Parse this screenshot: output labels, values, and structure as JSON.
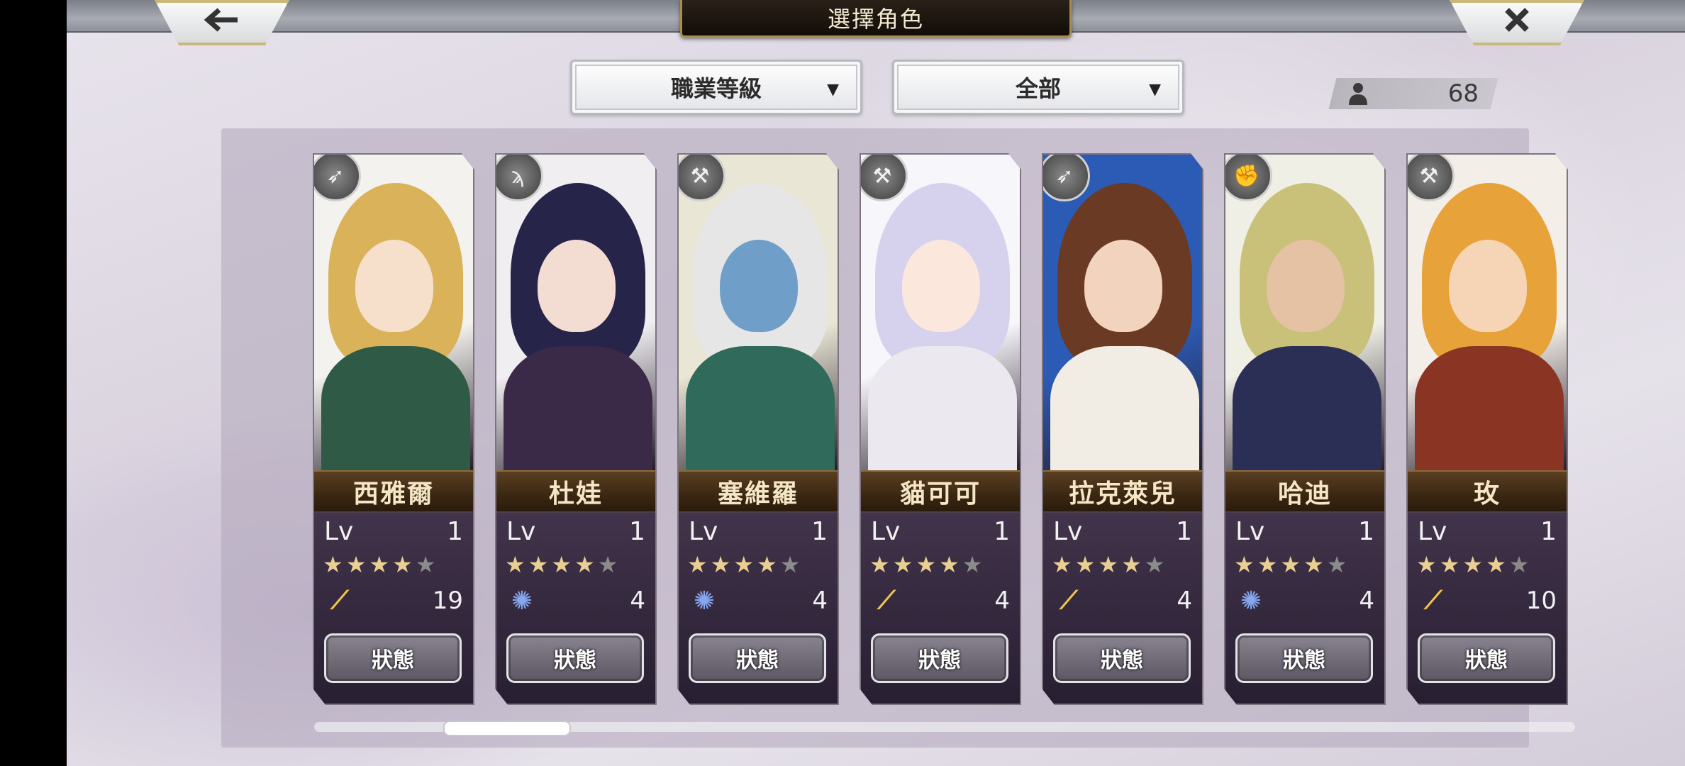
{
  "header": {
    "title": "選擇角色",
    "back_icon": "back-arrow-icon",
    "close_icon": "close-icon"
  },
  "filters": {
    "sort_label": "職業等級",
    "filter_label": "全部"
  },
  "character_count": "68",
  "status_label": "狀態",
  "lv_label": "Lv",
  "colors": {
    "star_on": "#e9cf92",
    "star_off": "#8b8b8b",
    "wing": "#f2c64c",
    "swirl": "#86a6f0"
  },
  "characters": [
    {
      "name": "西雅爾",
      "level": "1",
      "stars": 4,
      "skill_icon": "wing",
      "skill_value": "19",
      "job_icon": "crossbow-icon"
    },
    {
      "name": "杜娃",
      "level": "1",
      "stars": 4,
      "skill_icon": "swirl",
      "skill_value": "4",
      "job_icon": "staff-icon"
    },
    {
      "name": "塞維羅",
      "level": "1",
      "stars": 4,
      "skill_icon": "swirl",
      "skill_value": "4",
      "job_icon": "axe-icon"
    },
    {
      "name": "貓可可",
      "level": "1",
      "stars": 4,
      "skill_icon": "wing",
      "skill_value": "4",
      "job_icon": "axe-icon"
    },
    {
      "name": "拉克萊兒",
      "level": "1",
      "stars": 4,
      "skill_icon": "wing",
      "skill_value": "4",
      "job_icon": "crossbow-icon"
    },
    {
      "name": "哈迪",
      "level": "1",
      "stars": 4,
      "skill_icon": "swirl",
      "skill_value": "4",
      "job_icon": "fist-icon"
    },
    {
      "name": "玫",
      "level": "1",
      "stars": 4,
      "skill_icon": "wing",
      "skill_value": "10",
      "job_icon": "hammer-icon"
    }
  ]
}
